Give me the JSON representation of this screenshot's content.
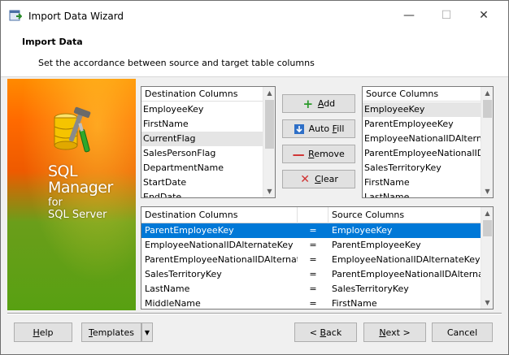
{
  "window": {
    "title": "Import Data Wizard",
    "minimize_glyph": "—",
    "maximize_glyph": "☐",
    "close_glyph": "✕"
  },
  "header": {
    "title": "Import Data",
    "subtitle": "Set the accordance between source and target table columns"
  },
  "banner": {
    "line1": "SQL",
    "line2": "Manager",
    "line3": "for",
    "line4": "SQL Server"
  },
  "destination": {
    "header": "Destination Columns",
    "items": [
      "EmployeeKey",
      "FirstName",
      "CurrentFlag",
      "SalesPersonFlag",
      "DepartmentName",
      "StartDate",
      "EndDate"
    ],
    "selected_index": 2
  },
  "source": {
    "header": "Source Columns",
    "items": [
      "EmployeeKey",
      "ParentEmployeeKey",
      "EmployeeNationalIDAlternateKey",
      "ParentEmployeeNationalIDAlternateKey",
      "SalesTerritoryKey",
      "FirstName",
      "LastName"
    ],
    "selected_index": 0
  },
  "actions": {
    "add": {
      "pre": "",
      "u": "A",
      "post": "dd",
      "icon": "plus-icon"
    },
    "autofill": {
      "pre": "Auto ",
      "u": "F",
      "post": "ill",
      "icon": "autofill-icon"
    },
    "remove": {
      "pre": "",
      "u": "R",
      "post": "emove",
      "icon": "minus-icon"
    },
    "clear": {
      "pre": "",
      "u": "C",
      "post": "lear",
      "icon": "x-icon"
    }
  },
  "mapping": {
    "headers": {
      "destination": "Destination Columns",
      "eq": "",
      "source": "Source Columns"
    },
    "rows": [
      {
        "dest": "ParentEmployeeKey",
        "eq": "=",
        "src": "EmployeeKey"
      },
      {
        "dest": "EmployeeNationalIDAlternateKey",
        "eq": "=",
        "src": "ParentEmployeeKey"
      },
      {
        "dest": "ParentEmployeeNationalIDAlternateKey",
        "eq": "=",
        "src": "EmployeeNationalIDAlternateKey"
      },
      {
        "dest": "SalesTerritoryKey",
        "eq": "=",
        "src": "ParentEmployeeNationalIDAlternateKey"
      },
      {
        "dest": "LastName",
        "eq": "=",
        "src": "SalesTerritoryKey"
      },
      {
        "dest": "MiddleName",
        "eq": "=",
        "src": "FirstName"
      }
    ],
    "selected_index": 0
  },
  "footer": {
    "help": {
      "u": "H",
      "post": "elp"
    },
    "templates": {
      "u": "T",
      "post": "emplates"
    },
    "back": {
      "pre": "< ",
      "u": "B",
      "post": "ack"
    },
    "next": {
      "pre": "",
      "u": "N",
      "post": "ext >"
    },
    "cancel": "Cancel"
  },
  "colors": {
    "selection": "#0078d7",
    "banner_orange": "#ff6a00",
    "banner_green": "#58a012"
  }
}
